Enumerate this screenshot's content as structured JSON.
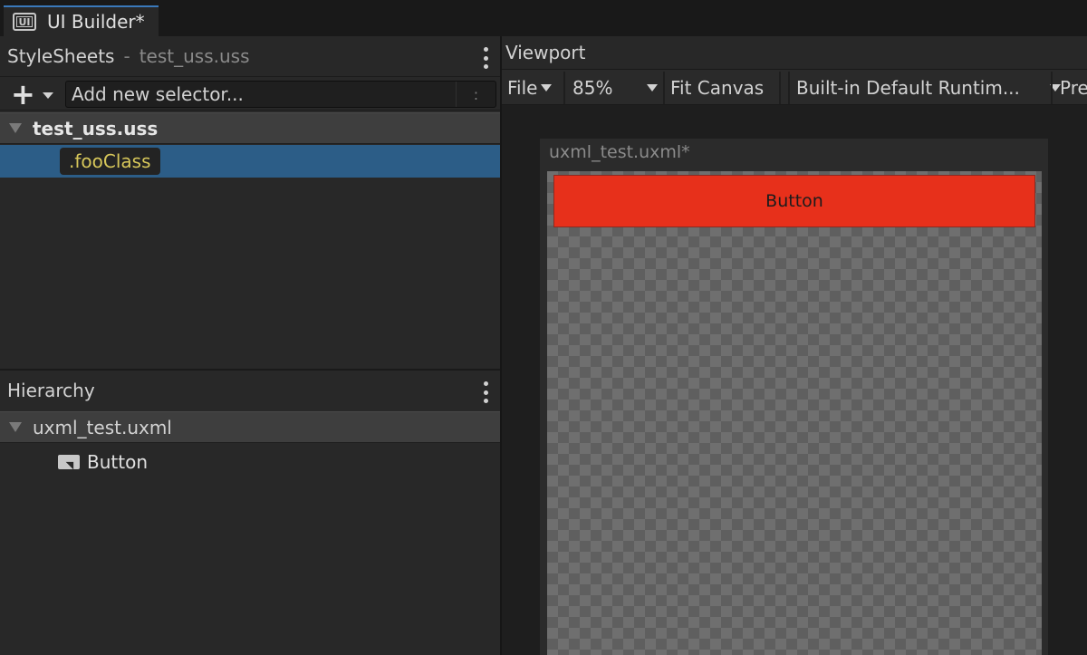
{
  "window": {
    "tab_icon_text": "UI",
    "tab_title": "UI Builder*"
  },
  "stylesheets": {
    "title": "StyleSheets",
    "separator": "-",
    "current_file": "test_uss.uss",
    "add_placeholder": "Add new selector...",
    "colon_button": ":",
    "sheet_name": "test_uss.uss",
    "selectors": [
      ".fooClass"
    ]
  },
  "hierarchy": {
    "title": "Hierarchy",
    "document": "uxml_test.uxml",
    "items": [
      "Button"
    ]
  },
  "viewport": {
    "title": "Viewport",
    "toolbar": {
      "file": "File",
      "zoom": "85%",
      "fit": "Fit Canvas",
      "theme": "Built-in Default Runtim...",
      "preview": "Pre"
    },
    "canvas_title": "uxml_test.uxml*",
    "button_text": "Button",
    "button_color": "#e7301b"
  },
  "colors": {
    "selection": "#2c5d87",
    "selector_text": "#d7c75a"
  }
}
